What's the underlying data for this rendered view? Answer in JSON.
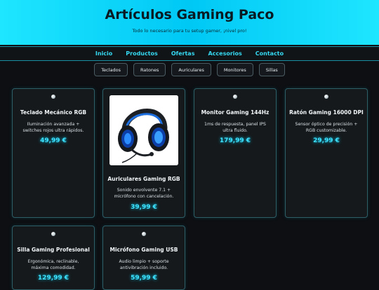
{
  "header": {
    "title": "Artículos Gaming Paco",
    "subtitle": "Todo lo necesario para tu setup gamer, ¡nivel pro!"
  },
  "nav": {
    "links": [
      "Inicio",
      "Productos",
      "Ofertas",
      "Accesorios",
      "Contacto"
    ]
  },
  "categories": [
    "Teclados",
    "Ratones",
    "Auriculares",
    "Monitores",
    "Sillas"
  ],
  "products": [
    {
      "name": "Teclado Mecánico RGB",
      "description": "Iluminación avanzada + switches rojos ultra rápidos.",
      "price": "49,99 €",
      "icon": "bullet-dot-icon"
    },
    {
      "name": "Auriculares Gaming RGB",
      "description": "Sonido envolvente 7.1 + micrófono con cancelación.",
      "price": "39,99 €",
      "icon": "headset-image"
    },
    {
      "name": "Monitor Gaming 144Hz",
      "description": "1ms de respuesta, panel IPS ultra fluido.",
      "price": "179,99 €",
      "icon": "bullet-dot-icon"
    },
    {
      "name": "Ratón Gaming 16000 DPI",
      "description": "Sensor óptico de precisión + RGB customizable.",
      "price": "29,99 €",
      "icon": "bullet-dot-icon"
    },
    {
      "name": "Silla Gaming Profesional",
      "description": "Ergonómica, reclinable, máxima comodidad.",
      "price": "129,99 €",
      "icon": "bullet-dot-icon"
    },
    {
      "name": "Micrófono Gaming USB",
      "description": "Audio limpio + soporte antivibración incluido.",
      "price": "59,99 €",
      "icon": "bullet-dot-icon"
    }
  ],
  "colors": {
    "accent": "#35d9f2",
    "header_gradient": "#1ee6ff",
    "background": "#0d0f12",
    "price": "#3fe3ff"
  }
}
